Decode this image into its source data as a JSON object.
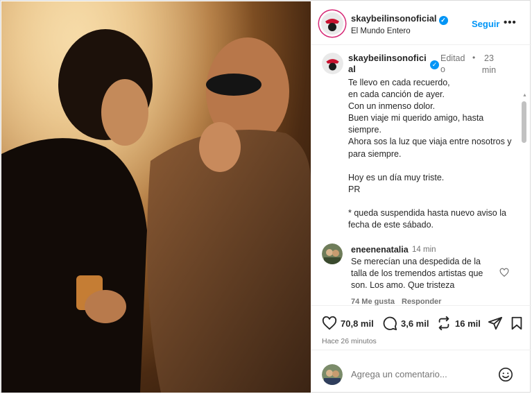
{
  "post": {
    "username": "skaybeilinsonoficial",
    "location": "El Mundo Entero",
    "follow_label": "Seguir",
    "more_label": "•••",
    "caption_username": "skaybeilinsonoficial",
    "caption_edited": "Editado",
    "caption_separator": "•",
    "caption_time": "23 min",
    "caption_text": "Te llevo en cada recuerdo,\nen cada canción de ayer.\nCon un inmenso dolor.\nBuen viaje mi querido amigo, hasta siempre.\nAhora sos la luz que viaja entre nosotros y para siempre.\n\nHoy es un día muy triste.\nPR\n\n* queda suspendida hasta nuevo aviso la fecha de este sábado."
  },
  "comment": {
    "username": "eneenenatalia",
    "time": "14 min",
    "text": "Se merecían una despedida de la talla de los tremendos artistas que son. Los amo. Que tristeza",
    "likes": "74 Me gusta",
    "reply_label": "Responder"
  },
  "actions": {
    "likes": "70,8 mil",
    "comments": "3,6 mil",
    "reposts": "16 mil",
    "posted_ago": "Hace 26 minutos"
  },
  "composer": {
    "placeholder": "Agrega un comentario..."
  },
  "icons": {
    "verified": "verified-badge-icon",
    "like": "heart-icon",
    "comment": "comment-bubble-icon",
    "repost": "repost-icon",
    "share": "paper-plane-icon",
    "save": "bookmark-icon",
    "emoji": "emoji-icon",
    "more": "more-dots-icon"
  },
  "colors": {
    "accent": "#0095f6",
    "text": "#262626",
    "muted": "#737373",
    "border": "#efefef"
  }
}
